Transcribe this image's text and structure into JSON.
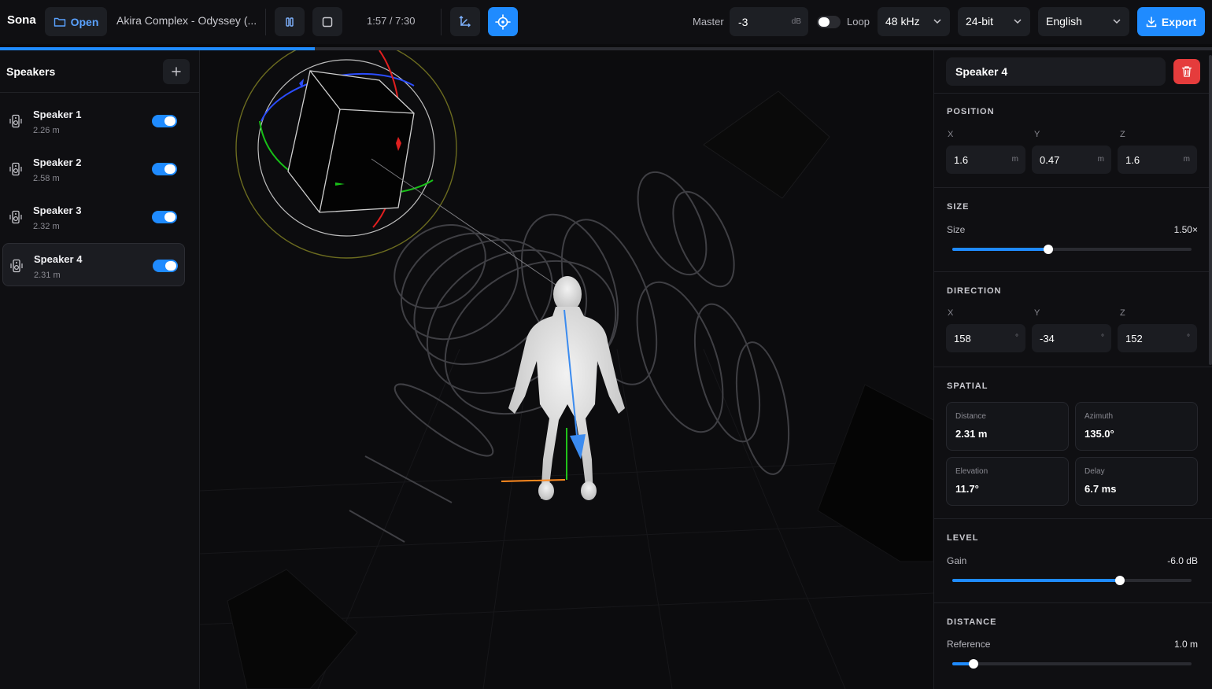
{
  "header": {
    "brand": "Sona",
    "open_label": "Open",
    "track_title": "Akira Complex - Odyssey (...",
    "time": "1:57 / 7:30",
    "master_label": "Master",
    "master_value": "-3",
    "master_unit": "dB",
    "loop_label": "Loop",
    "sample_rate": "48 kHz",
    "bit_depth": "24-bit",
    "language": "English",
    "export_label": "Export",
    "progress": 0.26,
    "accent_color": "#1f8bff"
  },
  "sidebar": {
    "title": "Speakers",
    "speakers": [
      {
        "name": "Speaker 1",
        "distance": "2.26 m",
        "enabled": true
      },
      {
        "name": "Speaker 2",
        "distance": "2.58 m",
        "enabled": true
      },
      {
        "name": "Speaker 3",
        "distance": "2.32 m",
        "enabled": true
      },
      {
        "name": "Speaker 4",
        "distance": "2.31 m",
        "enabled": true,
        "selected": true
      }
    ]
  },
  "panel": {
    "speaker_name": "Speaker 4",
    "position": {
      "title": "POSITION",
      "x_label": "X",
      "y_label": "Y",
      "z_label": "Z",
      "x": "1.6",
      "y": "0.47",
      "z": "1.6",
      "unit": "m"
    },
    "size": {
      "title": "SIZE",
      "label": "Size",
      "value": "1.50×",
      "level": 0.4
    },
    "direction": {
      "title": "DIRECTION",
      "x_label": "X",
      "y_label": "Y",
      "z_label": "Z",
      "x": "158",
      "y": "-34",
      "z": "152",
      "unit": "°"
    },
    "spatial": {
      "title": "SPATIAL",
      "distance_label": "Distance",
      "distance": "2.31 m",
      "azimuth_label": "Azimuth",
      "azimuth": "135.0°",
      "elevation_label": "Elevation",
      "elevation": "11.7°",
      "delay_label": "Delay",
      "delay": "6.7 ms"
    },
    "level": {
      "title": "LEVEL",
      "label": "Gain",
      "value": "-6.0 dB",
      "level": 0.7
    },
    "distance": {
      "title": "DISTANCE",
      "label": "Reference",
      "value": "1.0 m",
      "level": 0.09
    }
  }
}
